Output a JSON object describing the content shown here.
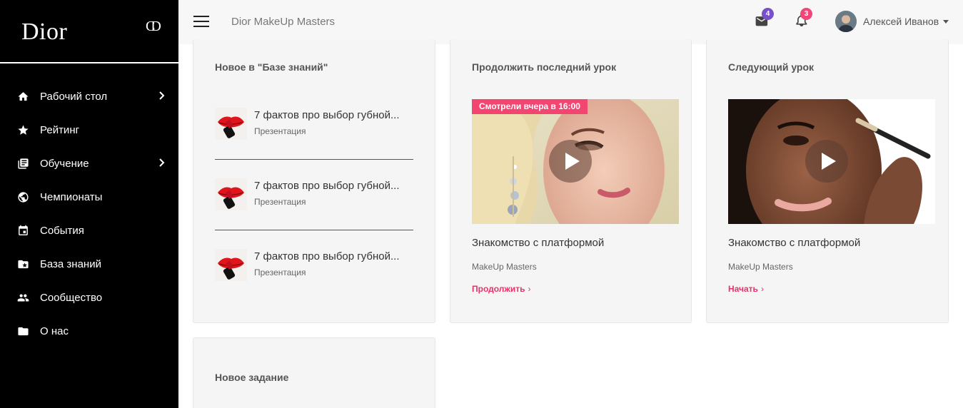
{
  "brand": {
    "logo": "Dior",
    "mark": "CD"
  },
  "topbar": {
    "title": "Dior MakeUp Masters",
    "mail_badge": "4",
    "notifications_badge": "3",
    "user_name": "Алексей Иванов"
  },
  "sidebar": {
    "items": [
      {
        "label": "Рабочий стол",
        "icon": "home-icon",
        "has_submenu": true
      },
      {
        "label": "Рейтинг",
        "icon": "star-icon",
        "has_submenu": false
      },
      {
        "label": "Обучение",
        "icon": "library-icon",
        "has_submenu": true
      },
      {
        "label": "Чемпионаты",
        "icon": "globe-icon",
        "has_submenu": false
      },
      {
        "label": "События",
        "icon": "calendar-icon",
        "has_submenu": false
      },
      {
        "label": "База знаний",
        "icon": "folder-star-icon",
        "has_submenu": false
      },
      {
        "label": "Сообщество",
        "icon": "people-icon",
        "has_submenu": false
      },
      {
        "label": "О нас",
        "icon": "folder-icon",
        "has_submenu": false
      }
    ]
  },
  "knowledge": {
    "title": "Новое в \"Базе знаний\"",
    "items": [
      {
        "name": "7 фактов про выбор губной...",
        "type": "Презентация"
      },
      {
        "name": "7 фактов про выбор губной...",
        "type": "Презентация"
      },
      {
        "name": "7 фактов про выбор губной...",
        "type": "Презентация"
      }
    ]
  },
  "last_lesson": {
    "title": "Продолжить последний урок",
    "ribbon": "Смотрели вчера в 16:00",
    "lesson_name": "Знакомство с платформой",
    "course": "MakeUp Masters",
    "action": "Продолжить",
    "chevron": "›"
  },
  "next_lesson": {
    "title": "Следующий урок",
    "lesson_name": "Знакомство с платформой",
    "course": "MakeUp Masters",
    "action": "Начать",
    "chevron": "›"
  },
  "new_task": {
    "title": "Новое задание"
  },
  "colors": {
    "accent": "#e8336a",
    "ribbon": "#f2456f",
    "mail_badge": "#7b4fc9",
    "notification_badge": "#f2457a",
    "sidebar_bg": "#000000",
    "card_bg": "#f5f5f5"
  }
}
